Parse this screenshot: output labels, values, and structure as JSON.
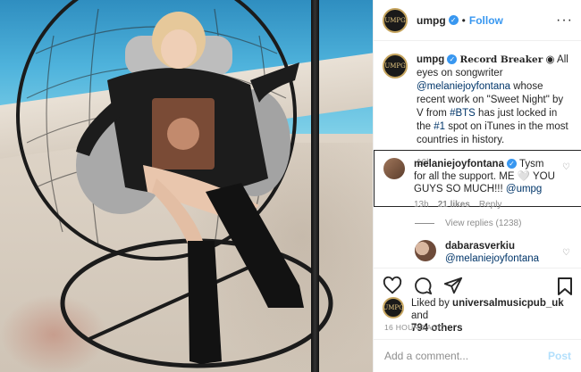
{
  "post": {
    "username": "umpg",
    "avatar_text": "UMPG",
    "follow_label": "Follow",
    "dot": "•",
    "more_icon": "more-icon"
  },
  "caption": {
    "username": "umpg",
    "prefix": "",
    "title": "Record Breaker",
    "text_before_mention": "All eyes on songwriter",
    "mention": "@melaniejoyfontana",
    "text_mid1": "whose recent work on \"Sweet Night\" by V from",
    "hashtag1": "#BTS",
    "text_mid2": "has just locked in the",
    "hashtag2": "#1",
    "text_end": "spot on iTunes in the most countries in history.",
    "time": "16h"
  },
  "comment": {
    "username": "melaniejoyfontana",
    "text": "Tysm for all the support. ME 🤍 YOU GUYS SO MUCH!!!",
    "mention": "@umpg",
    "time": "13h",
    "likes": "21 likes",
    "reply_label": "Reply"
  },
  "view_replies": "View replies (1238)",
  "reply": {
    "username": "dabarasverkiu",
    "mention": "@melaniejoyfontana"
  },
  "likes": {
    "prefix": "Liked by",
    "user": "universalmusicpub_uk",
    "and": "and",
    "others": "794 others"
  },
  "timestamp": "16 HOURS AGO",
  "add_comment": {
    "placeholder": "Add a comment...",
    "post_label": "Post"
  },
  "colors": {
    "accent": "#3897f0",
    "post_disabled": "#b2dffc",
    "muted": "#8e8e8e"
  }
}
